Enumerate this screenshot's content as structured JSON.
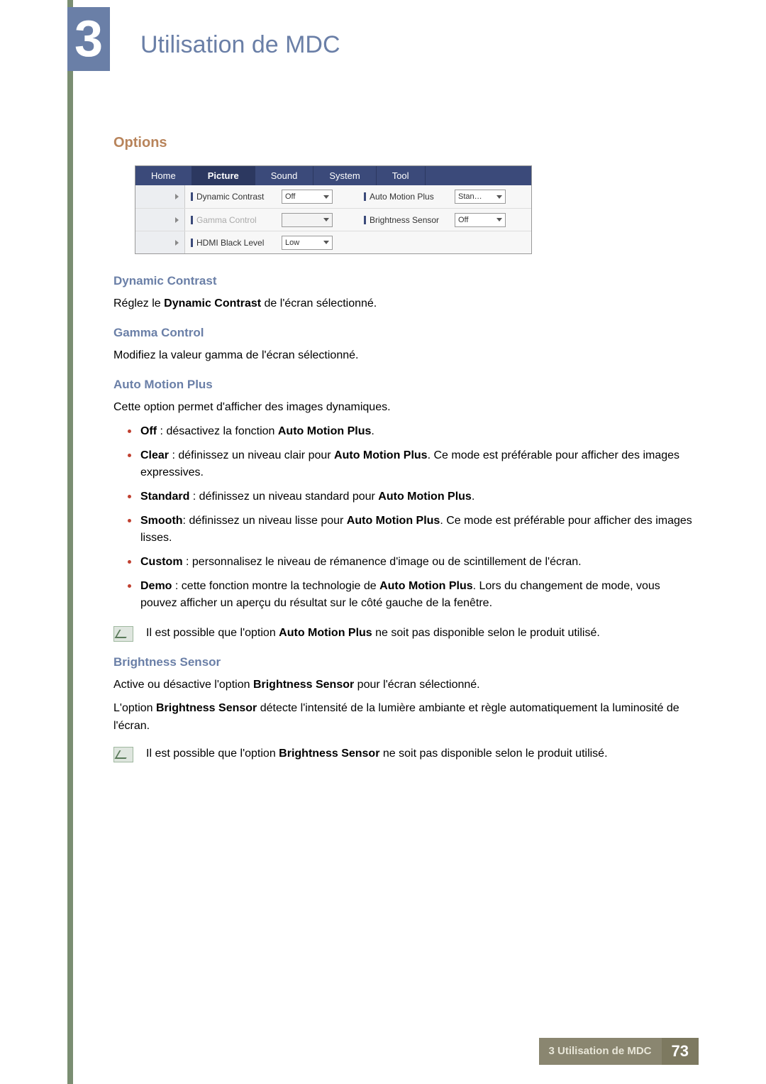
{
  "chapter": {
    "number": "3",
    "title": "Utilisation de MDC"
  },
  "section_heading": "Options",
  "ui": {
    "tabs": [
      "Home",
      "Picture",
      "Sound",
      "System",
      "Tool"
    ],
    "active_tab": "Picture",
    "rows": {
      "r1": {
        "left_label": "Dynamic Contrast",
        "left_value": "Off",
        "right_label": "Auto Motion Plus",
        "right_value": "Stan…"
      },
      "r2": {
        "left_label": "Gamma Control",
        "left_value": "",
        "right_label": "Brightness Sensor",
        "right_value": "Off"
      },
      "r3": {
        "left_label": "HDMI Black Level",
        "left_value": "Low"
      }
    }
  },
  "dynamic_contrast": {
    "heading": "Dynamic Contrast",
    "text_pre": "Réglez le ",
    "text_bold": "Dynamic Contrast",
    "text_post": " de l'écran sélectionné."
  },
  "gamma_control": {
    "heading": "Gamma Control",
    "text": "Modifiez la valeur gamma de l'écran sélectionné."
  },
  "auto_motion_plus": {
    "heading": "Auto Motion Plus",
    "intro": "Cette option permet d'afficher des images dynamiques.",
    "items": {
      "off": {
        "b": "Off",
        "mid": " : désactivez la fonction ",
        "b2": "Auto Motion Plus",
        "post": "."
      },
      "clear": {
        "b": "Clear",
        "mid": " : définissez un niveau clair pour ",
        "b2": "Auto Motion Plus",
        "post": ". Ce mode est préférable pour afficher des images expressives."
      },
      "standard": {
        "b": "Standard",
        "mid": " : définissez un niveau standard pour ",
        "b2": "Auto Motion Plus",
        "post": "."
      },
      "smooth": {
        "b": "Smooth",
        "mid": ": définissez un niveau lisse pour ",
        "b2": "Auto Motion Plus",
        "post": ". Ce mode est préférable pour afficher des images lisses."
      },
      "custom": {
        "b": "Custom",
        "mid": " : personnalisez le niveau de rémanence d'image ou de scintillement de l'écran.",
        "b2": "",
        "post": ""
      },
      "demo": {
        "b": "Demo",
        "mid": " : cette fonction montre la technologie de ",
        "b2": "Auto Motion Plus",
        "post": ". Lors du changement de mode, vous pouvez afficher un aperçu du résultat sur le côté gauche de la fenêtre."
      }
    },
    "note_pre": "Il est possible que l'option ",
    "note_bold": "Auto Motion Plus",
    "note_post": " ne soit pas disponible selon le produit utilisé."
  },
  "brightness_sensor": {
    "heading": "Brightness Sensor",
    "p1_pre": "Active ou désactive l'option ",
    "p1_bold": "Brightness Sensor",
    "p1_post": " pour l'écran sélectionné.",
    "p2_pre": "L'option ",
    "p2_bold": "Brightness Sensor",
    "p2_post": " détecte l'intensité de la lumière ambiante et règle automatiquement la luminosité de l'écran.",
    "note_pre": "Il est possible que l'option ",
    "note_bold": "Brightness Sensor",
    "note_post": " ne soit pas disponible selon le produit utilisé."
  },
  "footer": {
    "text": "3 Utilisation de MDC",
    "page": "73"
  }
}
